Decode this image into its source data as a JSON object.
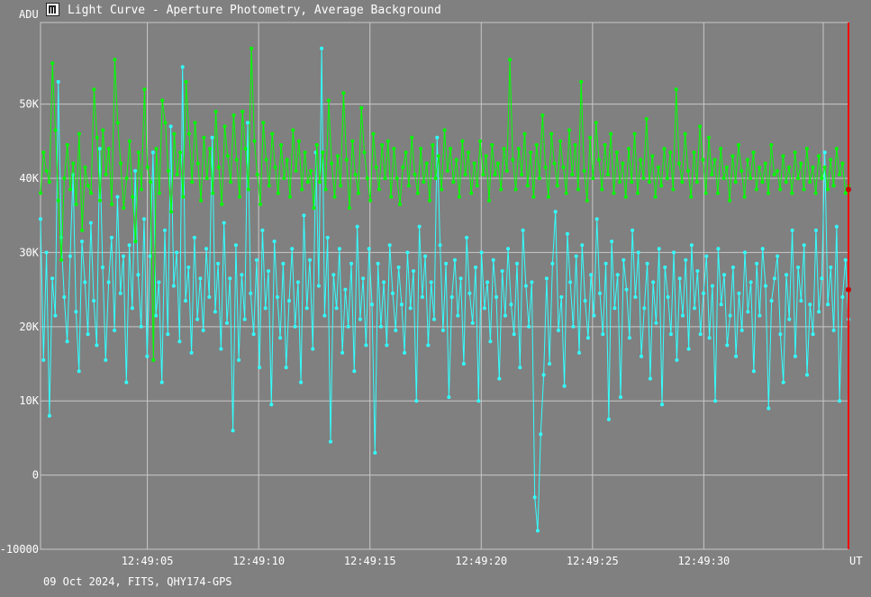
{
  "window": {
    "title": "Light Curve - Aperture Photometry, Average Background",
    "icon": "light-curve-app-icon"
  },
  "footer": {
    "caption": "09 Oct 2024, FITS, QHY174-GPS"
  },
  "colors": {
    "background": "#808080",
    "grid": "#c8c8c8",
    "series_green": "#00ff00",
    "series_cyan": "#33ffff",
    "cursor": "#ff0000"
  },
  "chart_data": {
    "type": "line",
    "ylabel": "ADU",
    "xlabel": "UT",
    "ylim": [
      -10000,
      61000
    ],
    "xlim": [
      "12:49:00.2",
      "12:49:36.5"
    ],
    "y_ticks": [
      -10000,
      0,
      10000,
      20000,
      30000,
      40000,
      50000
    ],
    "y_tick_labels": [
      "-10000",
      "0",
      "10K",
      "20K",
      "30K",
      "40K",
      "50K"
    ],
    "x_ticks": [
      "12:49:05",
      "12:49:10",
      "12:49:15",
      "12:49:20",
      "12:49:25",
      "12:49:30"
    ],
    "grid": true,
    "markers": true,
    "series": [
      {
        "color": "#00ff00",
        "x_start": "12:49:00.2",
        "x_end": "12:49:36.5",
        "values": [
          38000,
          43500,
          41000,
          39500,
          55500,
          46500,
          37000,
          29000,
          40000,
          44500,
          38500,
          42000,
          36500,
          46000,
          33000,
          41500,
          39000,
          38000,
          52000,
          45500,
          37000,
          46500,
          40500,
          44000,
          36500,
          56000,
          47500,
          42000,
          36000,
          40000,
          45000,
          37500,
          31500,
          43500,
          38500,
          52000,
          41500,
          39500,
          15500,
          44000,
          38000,
          50500,
          47500,
          41000,
          35500,
          46000,
          40500,
          43500,
          37500,
          53000,
          46000,
          39500,
          47500,
          42000,
          37000,
          45500,
          40000,
          44000,
          38000,
          49000,
          41500,
          36500,
          47000,
          43000,
          39500,
          48500,
          42500,
          37500,
          49000,
          44000,
          38500,
          57500,
          45000,
          40500,
          36500,
          47500,
          42500,
          39000,
          46000,
          41500,
          38000,
          44500,
          40000,
          42500,
          37500,
          46500,
          41000,
          45000,
          38500,
          43500,
          39500,
          41000,
          36000,
          44500,
          39500,
          43500,
          38500,
          50500,
          42000,
          37500,
          43000,
          39000,
          51500,
          42500,
          36000,
          45000,
          40500,
          38000,
          49500,
          43500,
          40000,
          37000,
          46000,
          41500,
          38500,
          44500,
          40000,
          45000,
          37500,
          44000,
          40000,
          36500,
          41500,
          43500,
          39000,
          45500,
          40500,
          38000,
          44000,
          39500,
          42000,
          37000,
          44500,
          40000,
          43000,
          38500,
          46500,
          41000,
          44000,
          39500,
          42500,
          37500,
          45000,
          40500,
          43500,
          38000,
          42000,
          39000,
          45000,
          40500,
          43000,
          37000,
          44500,
          40500,
          42000,
          38500,
          44000,
          41000,
          56000,
          42500,
          38500,
          44000,
          40500,
          46000,
          39000,
          43500,
          37500,
          44500,
          40000,
          48500,
          41500,
          37500,
          46000,
          42000,
          39000,
          45000,
          41500,
          38000,
          46500,
          40500,
          44500,
          38500,
          53000,
          41000,
          37000,
          45500,
          40000,
          47500,
          42500,
          38500,
          44500,
          40500,
          46000,
          38000,
          43500,
          39500,
          42000,
          37500,
          44000,
          39500,
          46000,
          38000,
          42500,
          40000,
          48000,
          39500,
          43000,
          37500,
          41500,
          39000,
          44000,
          40000,
          43500,
          38500,
          52000,
          42000,
          39500,
          46000,
          41000,
          37500,
          43500,
          39500,
          47000,
          42500,
          38000,
          45500,
          40500,
          42500,
          38000,
          44000,
          40000,
          41500,
          37000,
          43000,
          39500,
          44500,
          41000,
          37500,
          42500,
          40000,
          43500,
          38500,
          41500,
          39500,
          42000,
          38000,
          44500,
          40500,
          41000,
          38500,
          43000,
          39500,
          41500,
          38000,
          43500,
          40000,
          42000,
          38500,
          44000,
          39500,
          41500,
          38000,
          43000,
          40000,
          41500,
          38500,
          42500,
          39000,
          44000,
          40500,
          42000,
          38000,
          39000
        ]
      },
      {
        "color": "#33ffff",
        "x_start": "12:49:00.2",
        "x_end": "12:49:36.5",
        "values": [
          34500,
          15500,
          30000,
          8000,
          26500,
          21500,
          53000,
          32000,
          24000,
          18000,
          29500,
          40500,
          22000,
          14000,
          31500,
          26000,
          19000,
          34000,
          23500,
          17500,
          44000,
          28000,
          15500,
          26000,
          32000,
          19500,
          37500,
          24500,
          29500,
          12500,
          31000,
          22500,
          41000,
          27000,
          20000,
          34500,
          16000,
          29500,
          43500,
          21500,
          26000,
          12500,
          33000,
          19000,
          47000,
          25500,
          30000,
          18000,
          55000,
          23500,
          28000,
          16500,
          32000,
          21000,
          26500,
          19500,
          30500,
          24000,
          45500,
          22000,
          28500,
          17000,
          34000,
          20500,
          26500,
          6000,
          31000,
          15500,
          27000,
          21000,
          47500,
          24500,
          19000,
          29000,
          14500,
          33000,
          22500,
          27500,
          9500,
          31500,
          24000,
          18500,
          28500,
          14500,
          23500,
          30500,
          20000,
          26000,
          12500,
          35000,
          22500,
          29000,
          17000,
          43500,
          25500,
          57500,
          21500,
          32000,
          4500,
          27000,
          22500,
          30500,
          16500,
          25000,
          20000,
          28500,
          14000,
          33500,
          21000,
          26500,
          17500,
          30500,
          23000,
          3000,
          28500,
          20000,
          26000,
          17500,
          31000,
          24500,
          19500,
          28000,
          23000,
          16500,
          30000,
          22500,
          27500,
          10000,
          33500,
          24000,
          29500,
          17500,
          26000,
          21000,
          45500,
          31000,
          19500,
          28500,
          10500,
          24000,
          29000,
          21500,
          26500,
          15000,
          32000,
          24500,
          20500,
          28000,
          10000,
          30000,
          22500,
          26000,
          18000,
          29000,
          24000,
          13000,
          27500,
          21500,
          30500,
          23000,
          19000,
          28500,
          14500,
          33000,
          25500,
          20000,
          26000,
          -3000,
          -7500,
          5500,
          13500,
          26500,
          15000,
          28500,
          35500,
          19500,
          24000,
          12000,
          32500,
          26000,
          20000,
          29500,
          16500,
          31000,
          23500,
          18500,
          27000,
          21500,
          34500,
          24500,
          19000,
          28500,
          7500,
          31500,
          22500,
          27000,
          10500,
          29000,
          25000,
          18500,
          33000,
          24000,
          30000,
          16000,
          22500,
          28500,
          13000,
          26000,
          20500,
          30500,
          9500,
          28000,
          24000,
          19000,
          30000,
          15500,
          26500,
          21500,
          29000,
          17000,
          31000,
          22500,
          27500,
          19000,
          24500,
          29500,
          18500,
          25500,
          10000,
          30500,
          23000,
          27000,
          17500,
          21500,
          28000,
          16000,
          24500,
          19500,
          30000,
          22000,
          26000,
          14000,
          28500,
          21500,
          30500,
          25500,
          9000,
          23500,
          26500,
          29500,
          19000,
          12500,
          27000,
          21000,
          33000,
          16000,
          28000,
          23500,
          31000,
          13500,
          23000,
          19000,
          33000,
          22000,
          26500,
          43500,
          23000,
          28000,
          19500,
          33500,
          10000,
          24000,
          29000,
          21000
        ]
      }
    ],
    "cursor_markers": [
      {
        "series": "green",
        "value": 38500
      },
      {
        "series": "cyan",
        "value": 25000
      }
    ]
  }
}
